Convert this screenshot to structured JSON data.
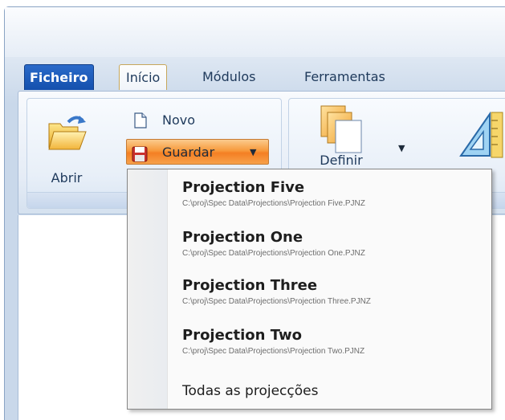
{
  "tabs": {
    "file": "Ficheiro",
    "home": "Início",
    "modules": "Módulos",
    "tools": "Ferramentas"
  },
  "ribbon": {
    "open_label": "Abrir",
    "new_label": "Novo",
    "save_label": "Guardar",
    "define_label": "Definir"
  },
  "recent_menu": {
    "items": [
      {
        "title": "Projection Five",
        "path": "C:\\proj\\Spec Data\\Projections\\Projection Five.PJNZ"
      },
      {
        "title": "Projection One",
        "path": "C:\\proj\\Spec Data\\Projections\\Projection One.PJNZ"
      },
      {
        "title": "Projection Three",
        "path": "C:\\proj\\Spec Data\\Projections\\Projection Three.PJNZ"
      },
      {
        "title": "Projection Two",
        "path": "C:\\proj\\Spec Data\\Projections\\Projection Two.PJNZ"
      }
    ],
    "all_label": "Todas as projecções"
  },
  "colors": {
    "file_tab": "#1a5bbf",
    "save_highlight": "#f79a3c",
    "ribbon_bg": "#dfe8f3"
  },
  "icons": {
    "open": "folder-open-icon",
    "new": "new-document-icon",
    "save": "floppy-disk-icon",
    "define": "stacked-pages-icon",
    "tool": "set-square-ruler-icon"
  }
}
